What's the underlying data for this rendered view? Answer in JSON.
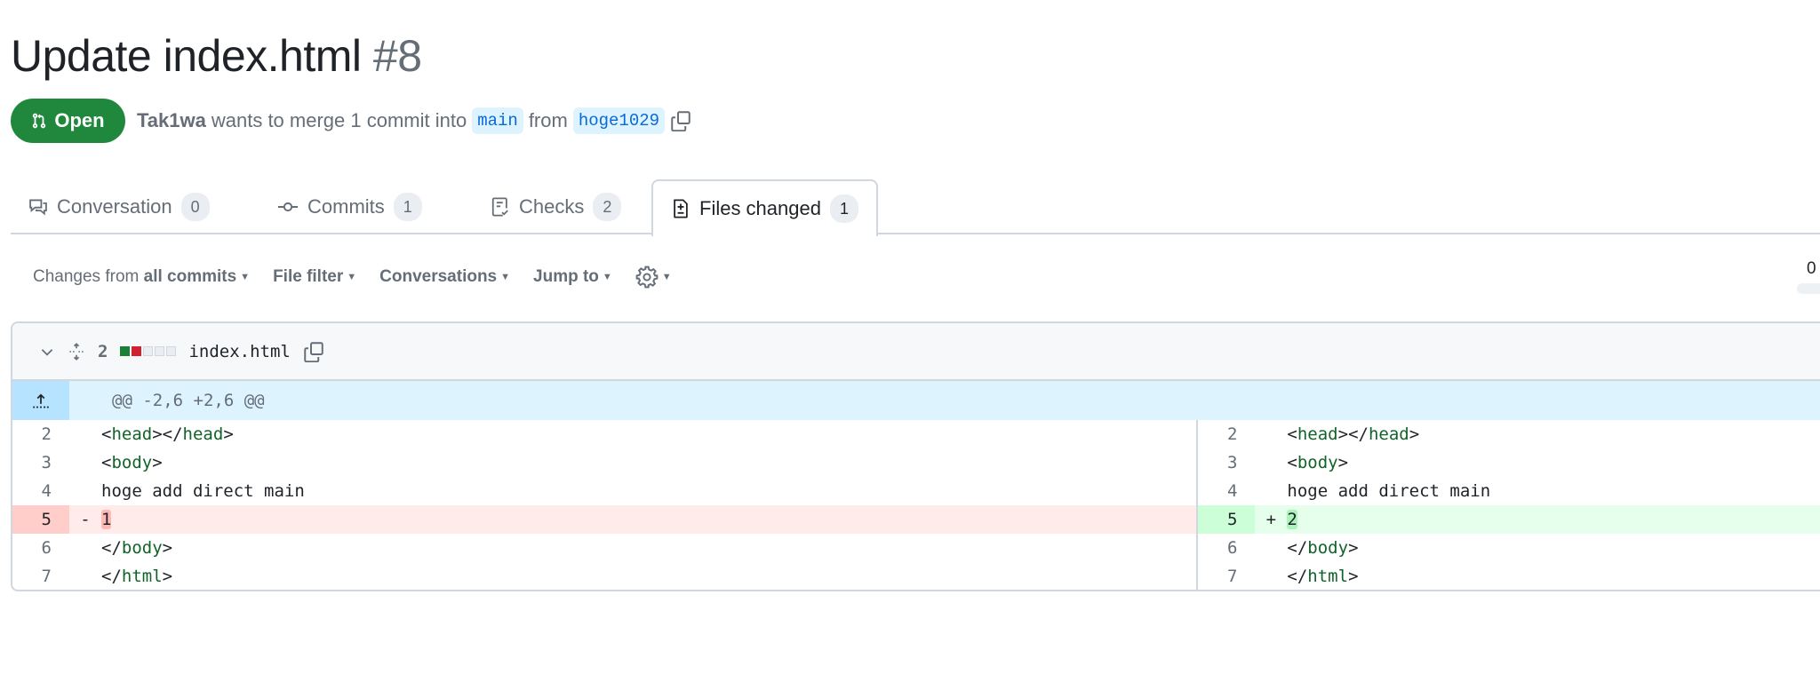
{
  "pr": {
    "title": "Update index.html",
    "number": "#8",
    "state": "Open",
    "author": "Tak1wa",
    "merge_text": "wants to merge 1 commit into",
    "base": "main",
    "from_text": "from",
    "head": "hoge1029"
  },
  "tabs": [
    {
      "label": "Conversation",
      "count": "0",
      "icon": "comment-discussion-icon"
    },
    {
      "label": "Commits",
      "count": "1",
      "icon": "git-commit-icon"
    },
    {
      "label": "Checks",
      "count": "2",
      "icon": "checklist-icon"
    },
    {
      "label": "Files changed",
      "count": "1",
      "icon": "file-diff-icon",
      "selected": true
    }
  ],
  "toolbar": {
    "changes_prefix": "Changes from",
    "changes_value": "all commits",
    "file_filter": "File filter",
    "conversations": "Conversations",
    "jump_to": "Jump to"
  },
  "viewed_count": "0",
  "file": {
    "changes": "2",
    "name": "index.html",
    "hunk": "@@ -2,6 +2,6 @@",
    "left": [
      {
        "n": "2",
        "type": "ctx",
        "parts": [
          [
            "<",
            ""
          ],
          [
            "head",
            "t"
          ],
          [
            "></",
            ""
          ],
          [
            "head",
            "t"
          ],
          [
            ">",
            ""
          ]
        ]
      },
      {
        "n": "3",
        "type": "ctx",
        "parts": [
          [
            "<",
            ""
          ],
          [
            "body",
            "t"
          ],
          [
            ">",
            ""
          ]
        ]
      },
      {
        "n": "4",
        "type": "ctx",
        "parts": [
          [
            "hoge add direct main",
            ""
          ]
        ]
      },
      {
        "n": "5",
        "type": "del",
        "marker": "-",
        "parts": [
          [
            "1",
            "h"
          ]
        ]
      },
      {
        "n": "6",
        "type": "ctx",
        "parts": [
          [
            "</",
            ""
          ],
          [
            "body",
            "t"
          ],
          [
            ">",
            ""
          ]
        ]
      },
      {
        "n": "7",
        "type": "ctx",
        "parts": [
          [
            "</",
            ""
          ],
          [
            "html",
            "t"
          ],
          [
            ">",
            ""
          ]
        ]
      }
    ],
    "right": [
      {
        "n": "2",
        "type": "ctx",
        "parts": [
          [
            "<",
            ""
          ],
          [
            "head",
            "t"
          ],
          [
            "></",
            ""
          ],
          [
            "head",
            "t"
          ],
          [
            ">",
            ""
          ]
        ]
      },
      {
        "n": "3",
        "type": "ctx",
        "parts": [
          [
            "<",
            ""
          ],
          [
            "body",
            "t"
          ],
          [
            ">",
            ""
          ]
        ]
      },
      {
        "n": "4",
        "type": "ctx",
        "parts": [
          [
            "hoge add direct main",
            ""
          ]
        ]
      },
      {
        "n": "5",
        "type": "add",
        "marker": "+",
        "parts": [
          [
            "2",
            "h"
          ]
        ]
      },
      {
        "n": "6",
        "type": "ctx",
        "parts": [
          [
            "</",
            ""
          ],
          [
            "body",
            "t"
          ],
          [
            ">",
            ""
          ]
        ]
      },
      {
        "n": "7",
        "type": "ctx",
        "parts": [
          [
            "</",
            ""
          ],
          [
            "html",
            "t"
          ],
          [
            ">",
            ""
          ]
        ]
      }
    ]
  },
  "colors": {
    "open": "#1f883d",
    "add": "#1a7f37",
    "del": "#cf222e"
  }
}
